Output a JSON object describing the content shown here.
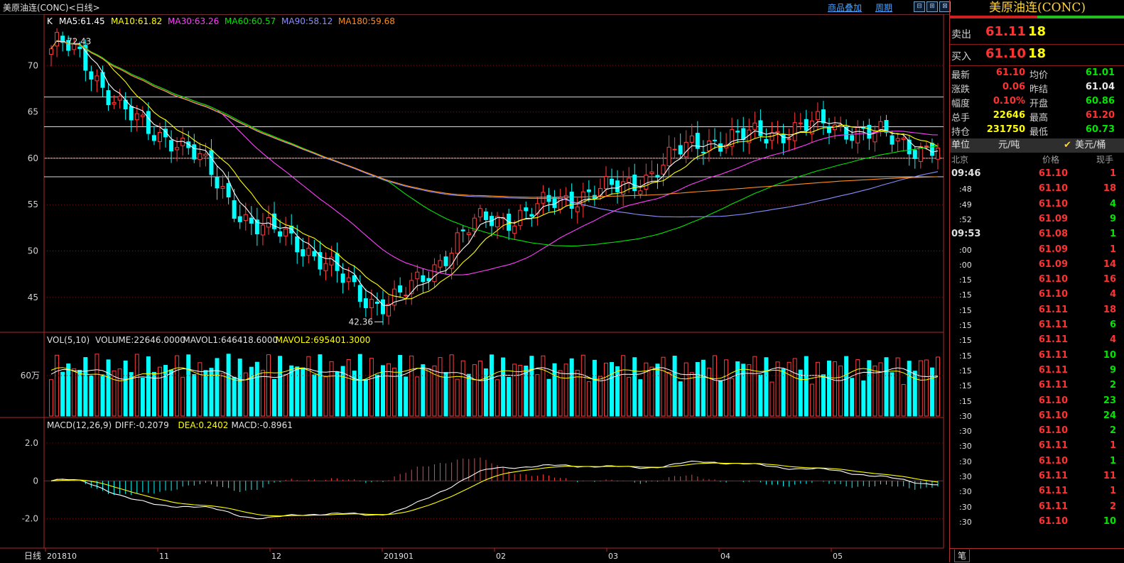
{
  "window": {
    "title": "美原油连(CONC)<日线>",
    "link_overlay": "商品叠加",
    "link_period": "周期"
  },
  "kline": {
    "legend": [
      {
        "text": "K",
        "color": "#ffffff"
      },
      {
        "text": "MA5:61.45",
        "color": "#ffffff"
      },
      {
        "text": "MA10:61.82",
        "color": "#ffff00"
      },
      {
        "text": "MA30:63.26",
        "color": "#ff40ff"
      },
      {
        "text": "MA60:60.57",
        "color": "#00e600"
      },
      {
        "text": "MA90:58.12",
        "color": "#8c8cff"
      },
      {
        "text": "MA180:59.68",
        "color": "#ff8c1a"
      }
    ],
    "y_ticks": [
      "70",
      "65",
      "60",
      "55",
      "50",
      "45"
    ],
    "y_tick_values": [
      70,
      65,
      60,
      55,
      50,
      45
    ],
    "high_label": "72.43",
    "low_label": "42.36",
    "bg_lines": [
      66.6,
      63.4,
      60.0,
      58.0
    ]
  },
  "volume": {
    "legend": [
      {
        "text": "VOL(5,10)",
        "color": "#e0e0e0"
      },
      {
        "text": "VOLUME:22646.0000",
        "color": "#e0e0e0"
      },
      {
        "text": "MAVOL1:646418.6000",
        "color": "#e0e0e0"
      },
      {
        "text": "MAVOL2:695401.3000",
        "color": "#ffff00"
      }
    ],
    "y_tick": "60万"
  },
  "macd": {
    "legend": [
      {
        "text": "MACD(12,26,9)",
        "color": "#e0e0e0"
      },
      {
        "text": "DIFF:-0.2079",
        "color": "#e0e0e0"
      },
      {
        "text": "DEA:0.2402",
        "color": "#ffff00"
      },
      {
        "text": "MACD:-0.8961",
        "color": "#e0e0e0"
      }
    ],
    "y_ticks": [
      "2.0",
      "0",
      "-2.0"
    ]
  },
  "x_axis": {
    "period_label": "日线",
    "labels": [
      "201810",
      "11",
      "12",
      "201901",
      "02",
      "03",
      "04",
      "05"
    ]
  },
  "quote": {
    "title": "美原油连(CONC)",
    "sell": {
      "label": "卖出",
      "price": "61.11",
      "qty": "18"
    },
    "buy": {
      "label": "买入",
      "price": "61.10",
      "qty": "18"
    },
    "stats": [
      {
        "l1": "最新",
        "v1": "61.10",
        "c1": "red",
        "l2": "均价",
        "v2": "61.01",
        "c2": "green"
      },
      {
        "l1": "涨跌",
        "v1": "0.06",
        "c1": "red",
        "l2": "昨结",
        "v2": "61.04",
        "c2": "white"
      },
      {
        "l1": "幅度",
        "v1": "0.10%",
        "c1": "red",
        "l2": "开盘",
        "v2": "60.86",
        "c2": "green"
      },
      {
        "l1": "总手",
        "v1": "22646",
        "c1": "yellow",
        "l2": "最高",
        "v2": "61.20",
        "c2": "red"
      },
      {
        "l1": "持仓",
        "v1": "231750",
        "c1": "yellow",
        "l2": "最低",
        "v2": "60.73",
        "c2": "green"
      }
    ],
    "unit_label": "单位",
    "unit_value": "元/吨",
    "unit_check": "✔",
    "unit_alt": "美元/桶",
    "ticks_header": {
      "time": "北京",
      "price": "价格",
      "qty": "现手"
    },
    "ticks": [
      {
        "time": "09:46",
        "price": "61.10",
        "qty": "1",
        "pc": "red",
        "qc": "red"
      },
      {
        "time": ":48",
        "price": "61.10",
        "qty": "18",
        "pc": "red",
        "qc": "red"
      },
      {
        "time": ":49",
        "price": "61.10",
        "qty": "4",
        "pc": "red",
        "qc": "green"
      },
      {
        "time": ":52",
        "price": "61.09",
        "qty": "9",
        "pc": "red",
        "qc": "green"
      },
      {
        "time": "09:53",
        "price": "61.08",
        "qty": "1",
        "pc": "red",
        "qc": "green"
      },
      {
        "time": ":00",
        "price": "61.09",
        "qty": "1",
        "pc": "red",
        "qc": "red"
      },
      {
        "time": ":00",
        "price": "61.09",
        "qty": "14",
        "pc": "red",
        "qc": "red"
      },
      {
        "time": ":15",
        "price": "61.10",
        "qty": "16",
        "pc": "red",
        "qc": "red"
      },
      {
        "time": ":15",
        "price": "61.10",
        "qty": "4",
        "pc": "red",
        "qc": "red"
      },
      {
        "time": ":15",
        "price": "61.11",
        "qty": "18",
        "pc": "red",
        "qc": "red"
      },
      {
        "time": ":15",
        "price": "61.11",
        "qty": "6",
        "pc": "red",
        "qc": "green"
      },
      {
        "time": ":15",
        "price": "61.11",
        "qty": "4",
        "pc": "red",
        "qc": "red"
      },
      {
        "time": ":15",
        "price": "61.11",
        "qty": "10",
        "pc": "red",
        "qc": "green"
      },
      {
        "time": ":15",
        "price": "61.11",
        "qty": "9",
        "pc": "red",
        "qc": "green"
      },
      {
        "time": ":15",
        "price": "61.11",
        "qty": "2",
        "pc": "red",
        "qc": "green"
      },
      {
        "time": ":15",
        "price": "61.10",
        "qty": "23",
        "pc": "red",
        "qc": "green"
      },
      {
        "time": ":30",
        "price": "61.10",
        "qty": "24",
        "pc": "red",
        "qc": "green"
      },
      {
        "time": ":30",
        "price": "61.10",
        "qty": "2",
        "pc": "red",
        "qc": "green"
      },
      {
        "time": ":30",
        "price": "61.11",
        "qty": "1",
        "pc": "red",
        "qc": "red"
      },
      {
        "time": ":30",
        "price": "61.10",
        "qty": "1",
        "pc": "red",
        "qc": "green"
      },
      {
        "time": ":30",
        "price": "61.11",
        "qty": "11",
        "pc": "red",
        "qc": "red"
      },
      {
        "time": ":30",
        "price": "61.11",
        "qty": "1",
        "pc": "red",
        "qc": "red"
      },
      {
        "time": ":30",
        "price": "61.11",
        "qty": "2",
        "pc": "red",
        "qc": "red"
      },
      {
        "time": ":30",
        "price": "61.10",
        "qty": "10",
        "pc": "red",
        "qc": "green"
      }
    ],
    "footer_tab": "笔"
  },
  "chart_data": {
    "type": "line",
    "title": "美原油连(CONC)<日线>",
    "x": [
      "201810",
      "11",
      "12",
      "201901",
      "02",
      "03",
      "04",
      "05"
    ],
    "ylim": [
      42,
      74
    ],
    "price_anchors": [
      {
        "x": "201810",
        "y": 72.4
      },
      {
        "x": "11",
        "y": 62.5
      },
      {
        "x": "12",
        "y": 52.0
      },
      {
        "x": "201901",
        "y": 44.5
      },
      {
        "x": "02",
        "y": 53.5
      },
      {
        "x": "03",
        "y": 56.5
      },
      {
        "x": "04",
        "y": 62.0
      },
      {
        "x": "05",
        "y": 63.5
      },
      {
        "x": "end",
        "y": 61.1
      }
    ],
    "high": 72.43,
    "low": 42.36,
    "series": [
      {
        "name": "MA5",
        "last": 61.45,
        "color": "#ffffff"
      },
      {
        "name": "MA10",
        "last": 61.82,
        "color": "#ffff00"
      },
      {
        "name": "MA30",
        "last": 63.26,
        "color": "#ff40ff"
      },
      {
        "name": "MA60",
        "last": 60.57,
        "color": "#00e600"
      },
      {
        "name": "MA90",
        "last": 58.12,
        "color": "#8c8cff"
      },
      {
        "name": "MA180",
        "last": 59.68,
        "color": "#ff8c1a"
      }
    ],
    "volume": {
      "VOLUME": 22646,
      "MAVOL1": 646418.6,
      "MAVOL2": 695401.3
    },
    "macd": {
      "DIFF": -0.2079,
      "DEA": 0.2402,
      "MACD": -0.8961,
      "ylim": [
        -3.4,
        2.6
      ]
    }
  }
}
